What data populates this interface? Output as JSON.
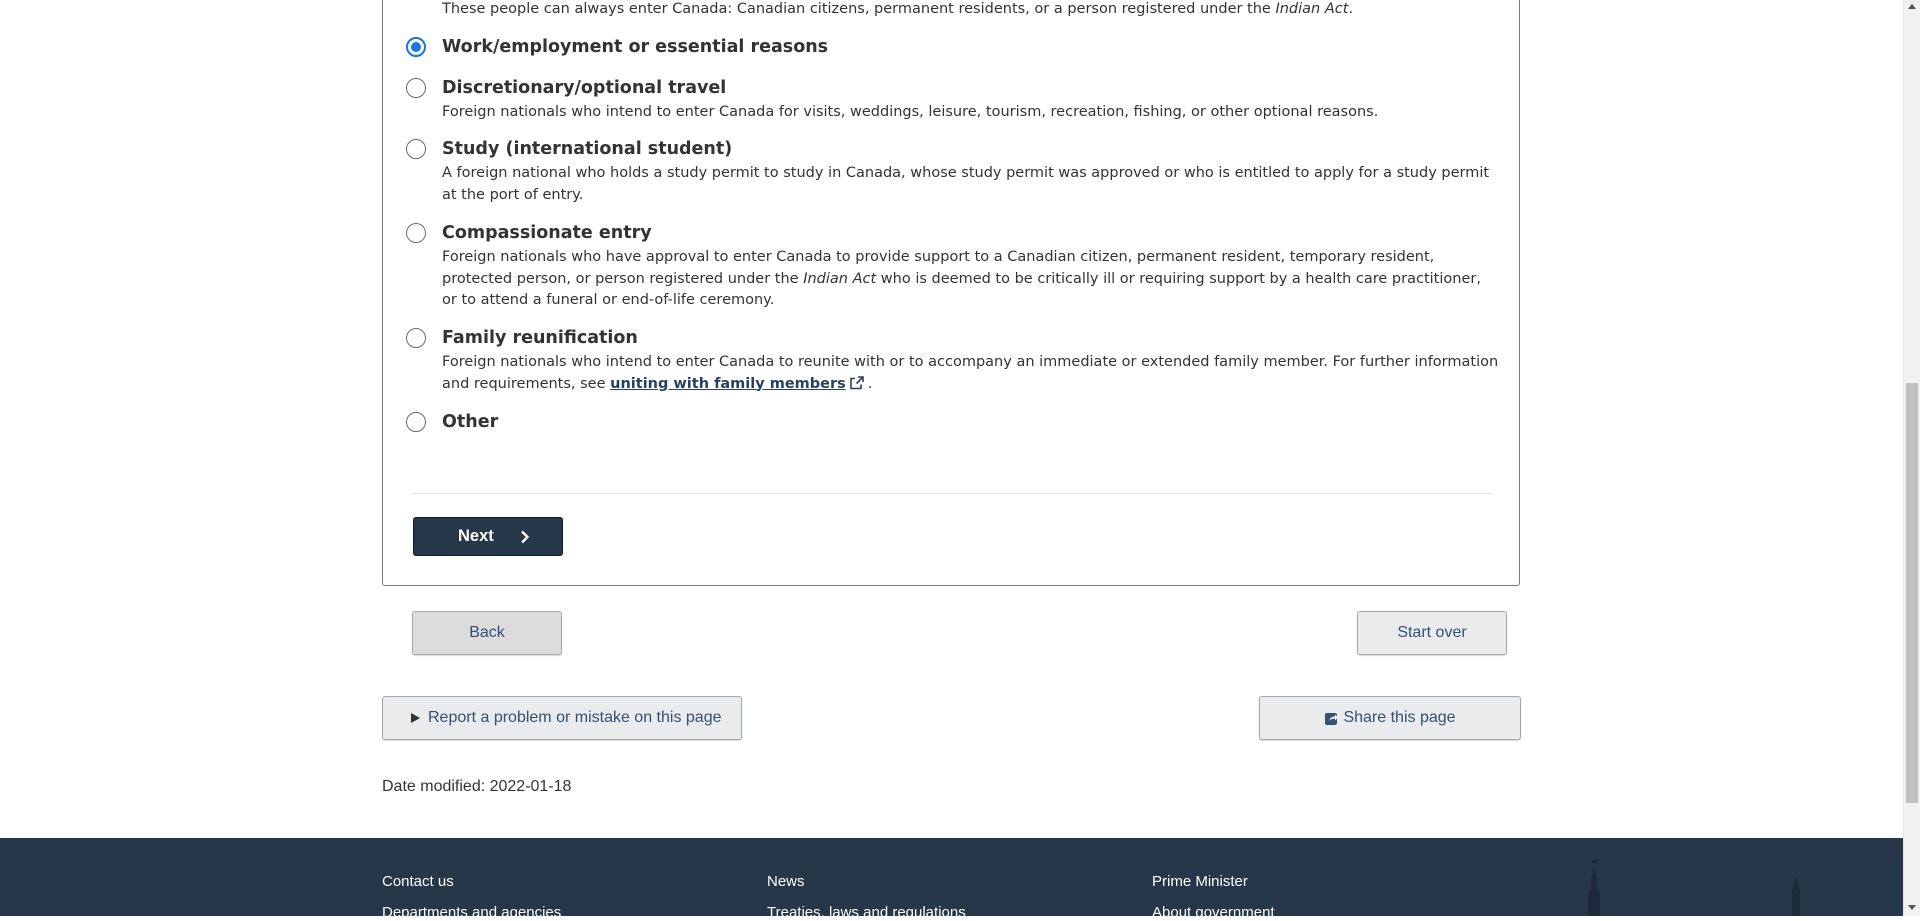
{
  "intro": {
    "text_before": "These people can always enter Canada: Canadian citizens, permanent residents, or a person registered under the ",
    "text_italic": "Indian Act",
    "text_after": "."
  },
  "options": [
    {
      "label": "Work/employment or essential reasons",
      "checked": true
    },
    {
      "label": "Discretionary/optional travel",
      "desc": "Foreign nationals who intend to enter Canada for visits, weddings, leisure, tourism, recreation, fishing, or other optional reasons."
    },
    {
      "label": "Study (international student)",
      "desc": "A foreign national who holds a study permit to study in Canada, whose study permit was approved or who is entitled to apply for a study permit at the port of entry."
    },
    {
      "label": "Compassionate entry",
      "desc_before": "Foreign nationals who have approval to enter Canada to provide support to a Canadian citizen, permanent resident, temporary resident, protected person, or person registered under the ",
      "desc_italic": "Indian Act",
      "desc_after": " who is deemed to be critically ill or requiring support by a health care practitioner, or to attend a funeral or end-of-life ceremony."
    },
    {
      "label": "Family reunification",
      "desc_before": "Foreign nationals who intend to enter Canada to reunite with or to accompany an immediate or extended family member. For further information and requirements, see ",
      "link": "uniting with family members",
      "desc_after": "."
    },
    {
      "label": "Other"
    }
  ],
  "buttons": {
    "next": "Next",
    "back": "Back",
    "start_over": "Start over",
    "report": "Report a problem or mistake on this page",
    "share": "Share this page"
  },
  "date_modified": "Date modified: 2022-01-18",
  "footer": {
    "col1": [
      "Contact us",
      "Departments and agencies"
    ],
    "col2": [
      "News",
      "Treaties, laws and regulations"
    ],
    "col3": [
      "Prime Minister",
      "About government"
    ]
  },
  "colors": {
    "primary_button": "#26374a",
    "radio_checked": "#1a73e8",
    "footer_bg": "#26374a",
    "link": "#284162"
  }
}
